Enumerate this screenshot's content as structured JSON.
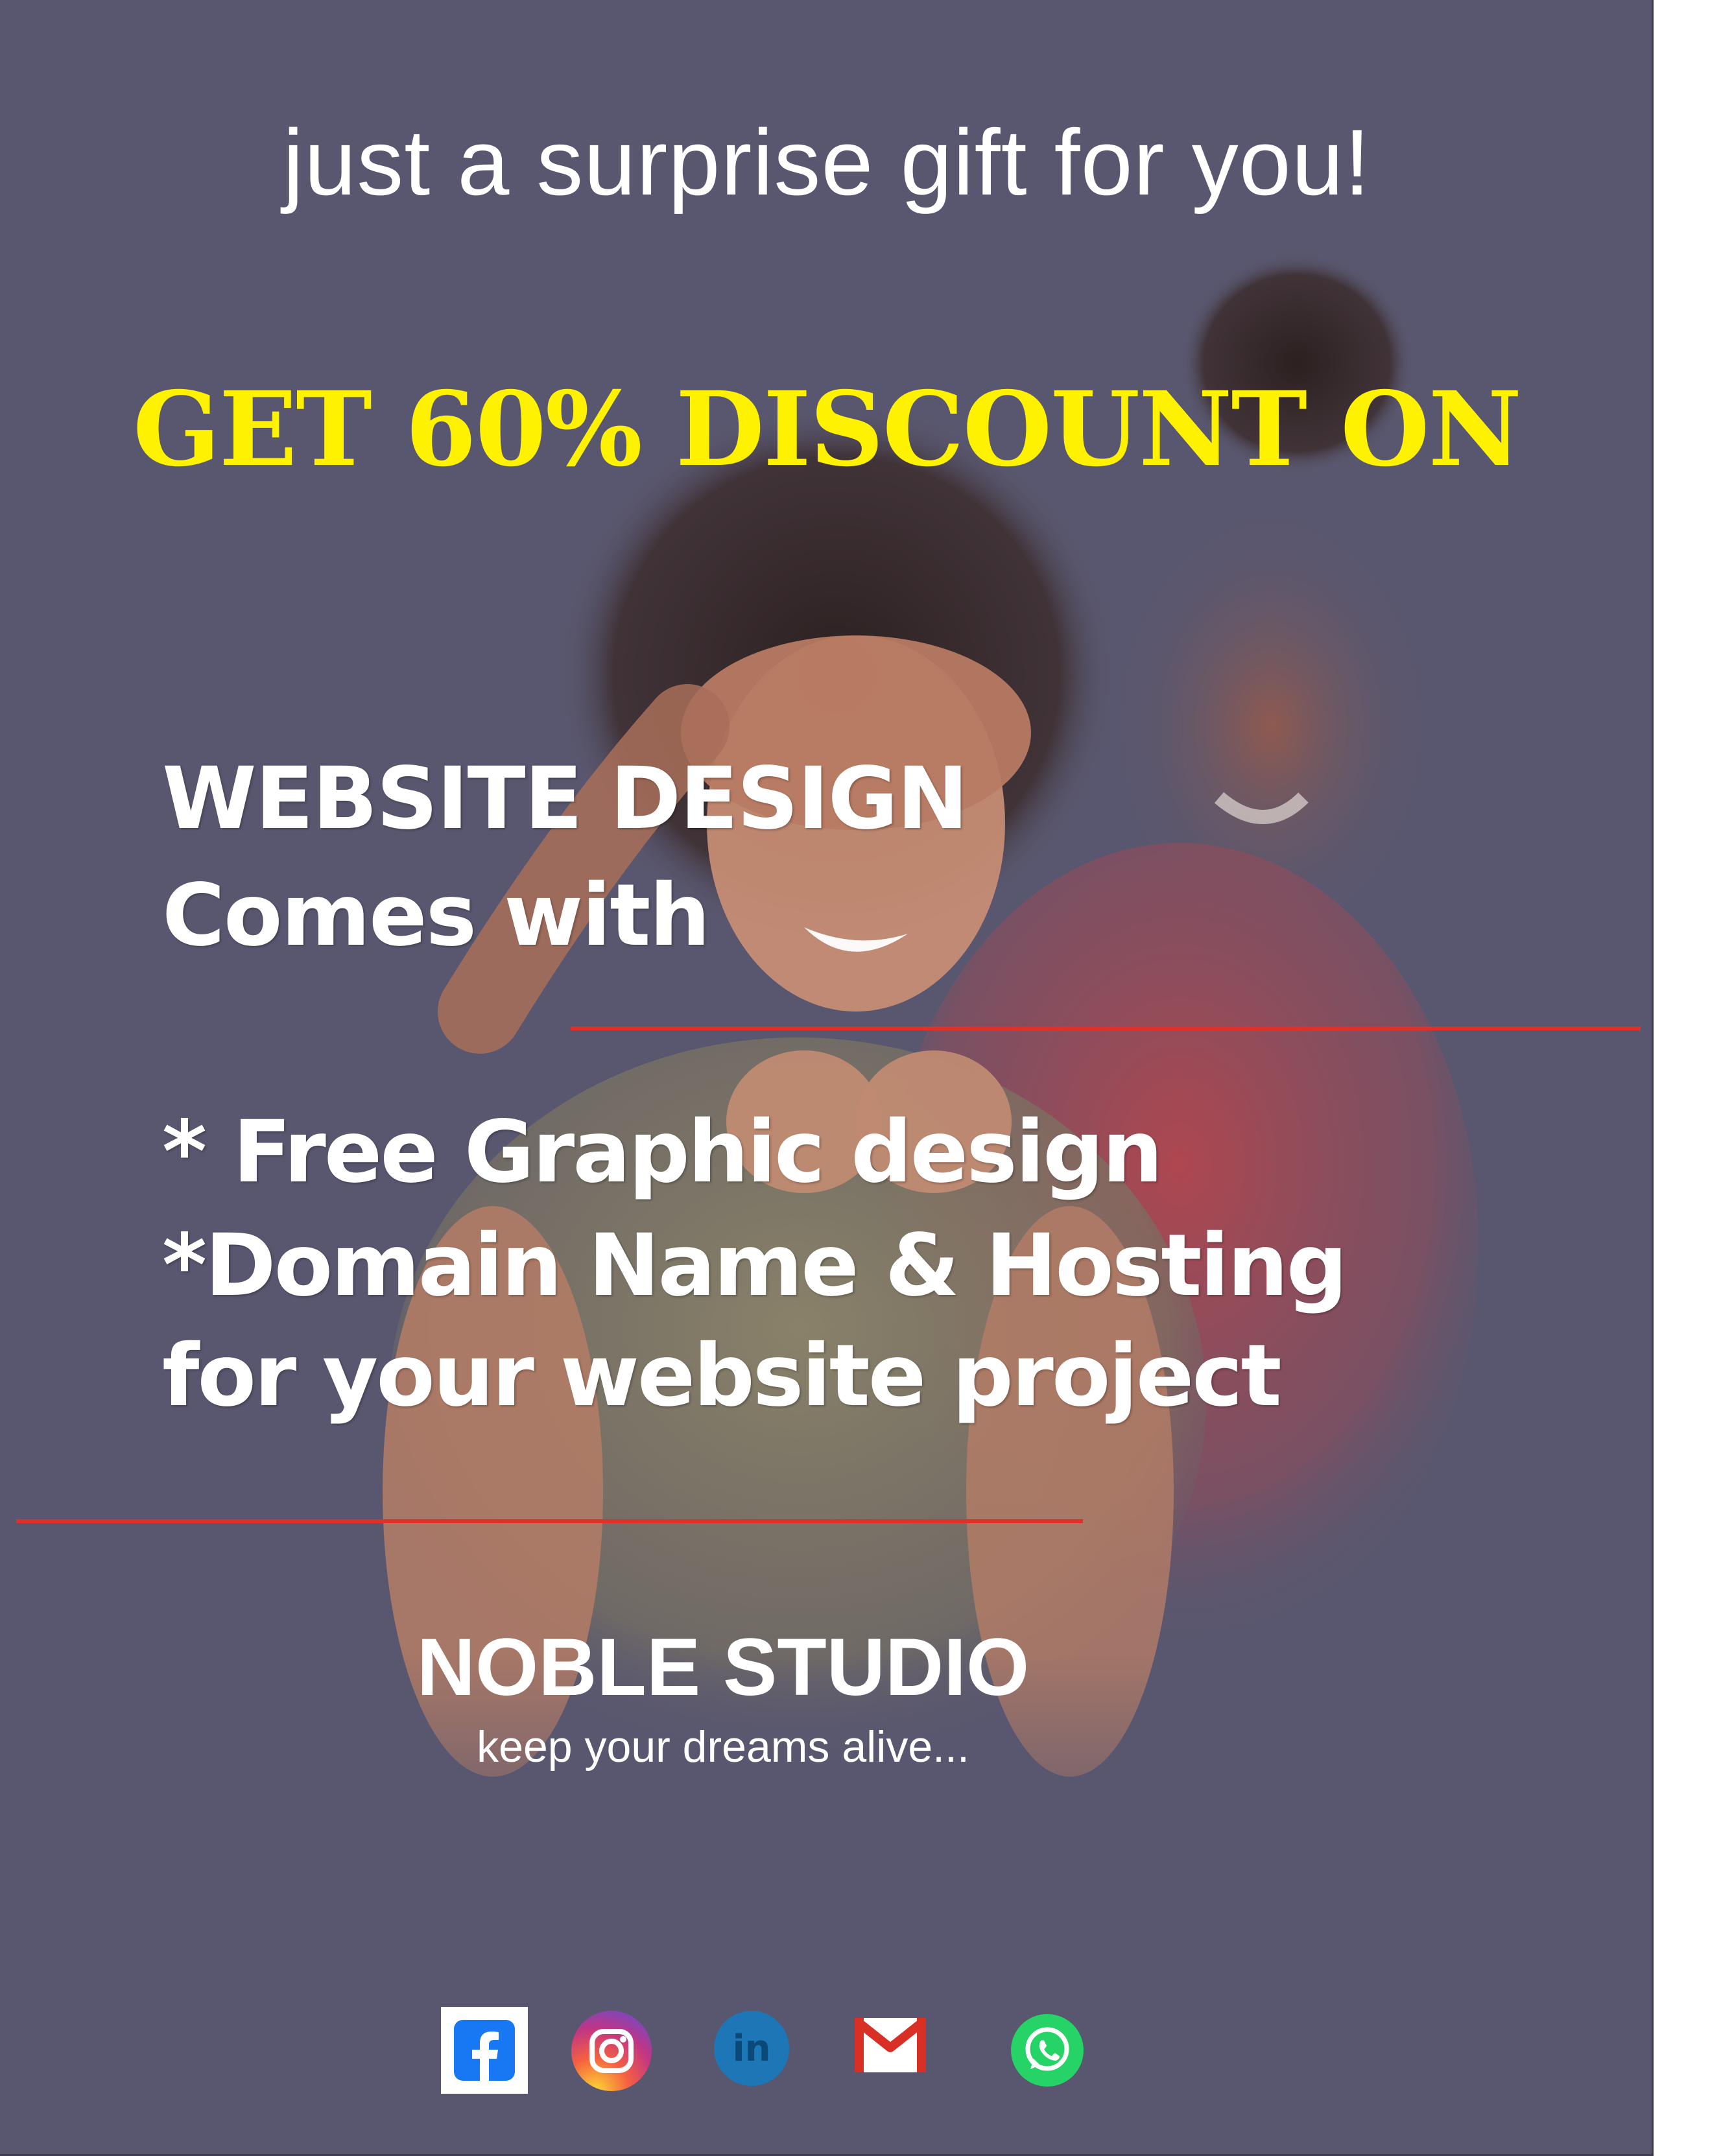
{
  "tagline": "just a surprise gift for you!",
  "headline": "GET 60% DISCOUNT ON",
  "service": "WEBSITE DESIGN",
  "comes_with": "Comes with",
  "perks": [
    "* Free Graphic design",
    "*Domain Name & Hosting",
    "for your website project"
  ],
  "brand": {
    "name": "NOBLE STUDIO",
    "slogan": "keep your dreams alive..."
  },
  "social_icons": [
    "facebook-icon",
    "instagram-icon",
    "linkedin-icon",
    "gmail-icon",
    "whatsapp-icon"
  ],
  "colors": {
    "background": "#59576f",
    "headline": "#fff200",
    "text": "#ffffff",
    "rule": "#e0302a"
  }
}
